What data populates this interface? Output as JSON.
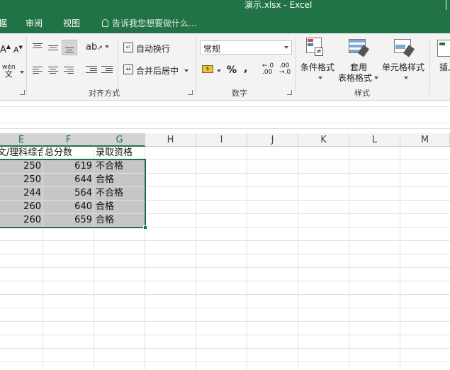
{
  "window": {
    "title": "演示.xlsx - Excel"
  },
  "tabs": {
    "data_partial": "据",
    "review": "审阅",
    "view": "视图"
  },
  "tell_me": {
    "placeholder": "告诉我您想要做什么..."
  },
  "ribbon": {
    "wrap_text": "自动换行",
    "merge_center": "合并后居中",
    "alignment_label": "对齐方式",
    "number_format_value": "常规",
    "percent_symbol": "%",
    "comma_symbol": ",",
    "number_label": "数字",
    "conditional_format": "条件格式",
    "table_format_line1": "套用",
    "table_format_line2": "表格格式",
    "cell_styles": "单元格样式",
    "styles_label": "样式",
    "insert_partial": "插入",
    "phonetic_top": "wén",
    "phonetic_bottom": "文"
  },
  "columns": [
    "E",
    "F",
    "G",
    "H",
    "I",
    "J",
    "K",
    "L",
    "M"
  ],
  "header_row": {
    "e": "文/理科综合",
    "f": "总分数",
    "g": "录取资格"
  },
  "rows": [
    {
      "e": "250",
      "f": "619",
      "g": "不合格"
    },
    {
      "e": "250",
      "f": "644",
      "g": "合格"
    },
    {
      "e": "244",
      "f": "564",
      "g": "不合格"
    },
    {
      "e": "260",
      "f": "640",
      "g": "合格"
    },
    {
      "e": "260",
      "f": "659",
      "g": "合格"
    }
  ],
  "colors": {
    "accent": "#217346",
    "selection": "#c6c6c6"
  }
}
